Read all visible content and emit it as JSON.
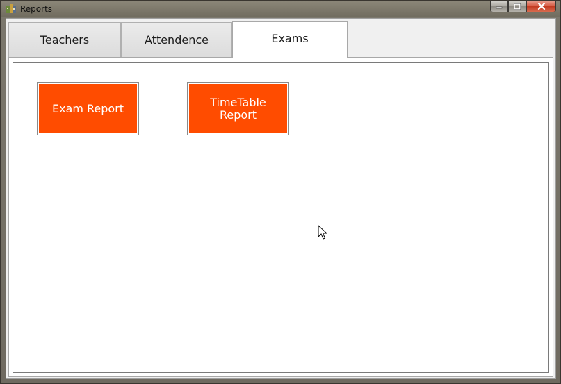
{
  "window": {
    "title": "Reports"
  },
  "tabs": [
    {
      "label": "Teachers",
      "active": false
    },
    {
      "label": "Attendence",
      "active": false
    },
    {
      "label": "Exams",
      "active": true
    }
  ],
  "exams_panel": {
    "buttons": [
      {
        "label": "Exam Report"
      },
      {
        "label": "TimeTable\nReport"
      }
    ]
  },
  "colors": {
    "button_face": "#ff4c00",
    "button_text": "#ffffff",
    "panel_background": "#ffffff"
  },
  "icons": {
    "app": "app-icon",
    "minimize": "minimize-icon",
    "maximize": "maximize-icon",
    "close": "close-icon",
    "cursor": "mouse-pointer-icon"
  }
}
